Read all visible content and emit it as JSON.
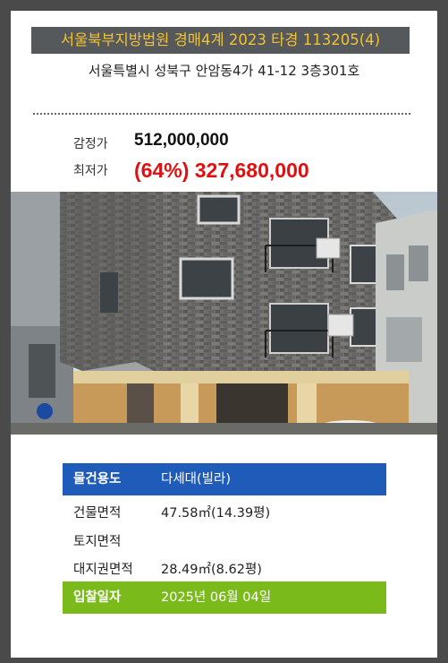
{
  "court_case": "서울북부지방법원 경매4계 2023 타경 113205(4)",
  "address": "서울특별시 성북구 안암동4가 41-12 3층301호",
  "prices": {
    "appraisal_label": "감정가",
    "appraisal_value": "512,000,000",
    "minimum_label": "최저가",
    "minimum_value": "(64%) 327,680,000"
  },
  "details": {
    "usage_label": "물건용도",
    "usage_value": "다세대(빌라)",
    "building_area_label": "건물면적",
    "building_area_value": "47.58㎡(14.39평)",
    "land_area_label": "토지면적",
    "land_area_value": "",
    "land_right_label": "대지권면적",
    "land_right_value": "28.49㎡(8.62평)",
    "bid_date_label": "입찰일자",
    "bid_date_value": "2025년 06월 04일"
  },
  "colors": {
    "banner_bg": "#56595c",
    "banner_text": "#f2c232",
    "minimum_price": "#e01010",
    "usage_row": "#1f5bb8",
    "bid_date_row": "#7bba1b",
    "frame": "#4a4a4a"
  }
}
